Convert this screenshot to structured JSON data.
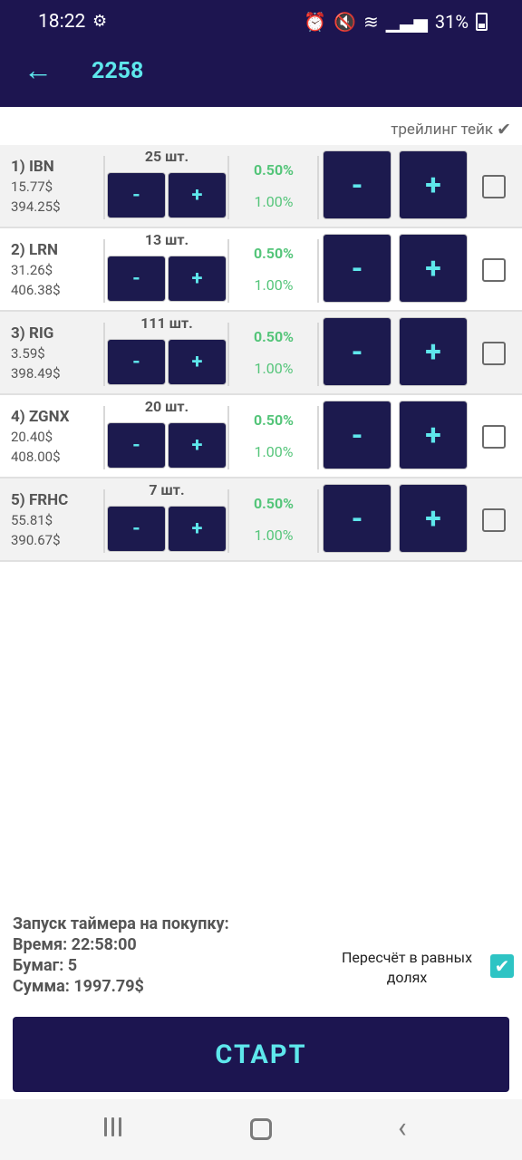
{
  "status_bar": {
    "time": "18:22",
    "battery": "31%"
  },
  "header": {
    "title": "2258"
  },
  "trailing": {
    "label": "трейлинг тейк"
  },
  "rows": [
    {
      "name": "1) IBN",
      "price": "15.77$",
      "total": "394.25$",
      "qty": "25 шт.",
      "pct1": "0.50%",
      "pct2": "1.00%"
    },
    {
      "name": "2) LRN",
      "price": "31.26$",
      "total": "406.38$",
      "qty": "13 шт.",
      "pct1": "0.50%",
      "pct2": "1.00%"
    },
    {
      "name": "3) RIG",
      "price": "3.59$",
      "total": "398.49$",
      "qty": "111 шт.",
      "pct1": "0.50%",
      "pct2": "1.00%"
    },
    {
      "name": "4) ZGNX",
      "price": "20.40$",
      "total": "408.00$",
      "qty": "20 шт.",
      "pct1": "0.50%",
      "pct2": "1.00%"
    },
    {
      "name": "5) FRHC",
      "price": "55.81$",
      "total": "390.67$",
      "qty": "7 шт.",
      "pct1": "0.50%",
      "pct2": "1.00%"
    }
  ],
  "buttons": {
    "minus": "-",
    "plus": "+"
  },
  "summary": {
    "heading": "Запуск таймера на покупку:",
    "time": "Время: 22:58:00",
    "papers": "Бумаг: 5",
    "sum": "Сумма: 1997.79$"
  },
  "recalc": {
    "label": "Пересчёт в равных долях",
    "checked": true
  },
  "start": {
    "label": "СТАРТ"
  },
  "colors": {
    "bar": "#1d1550",
    "accent": "#5ee7ec",
    "green": "#55c57a"
  }
}
